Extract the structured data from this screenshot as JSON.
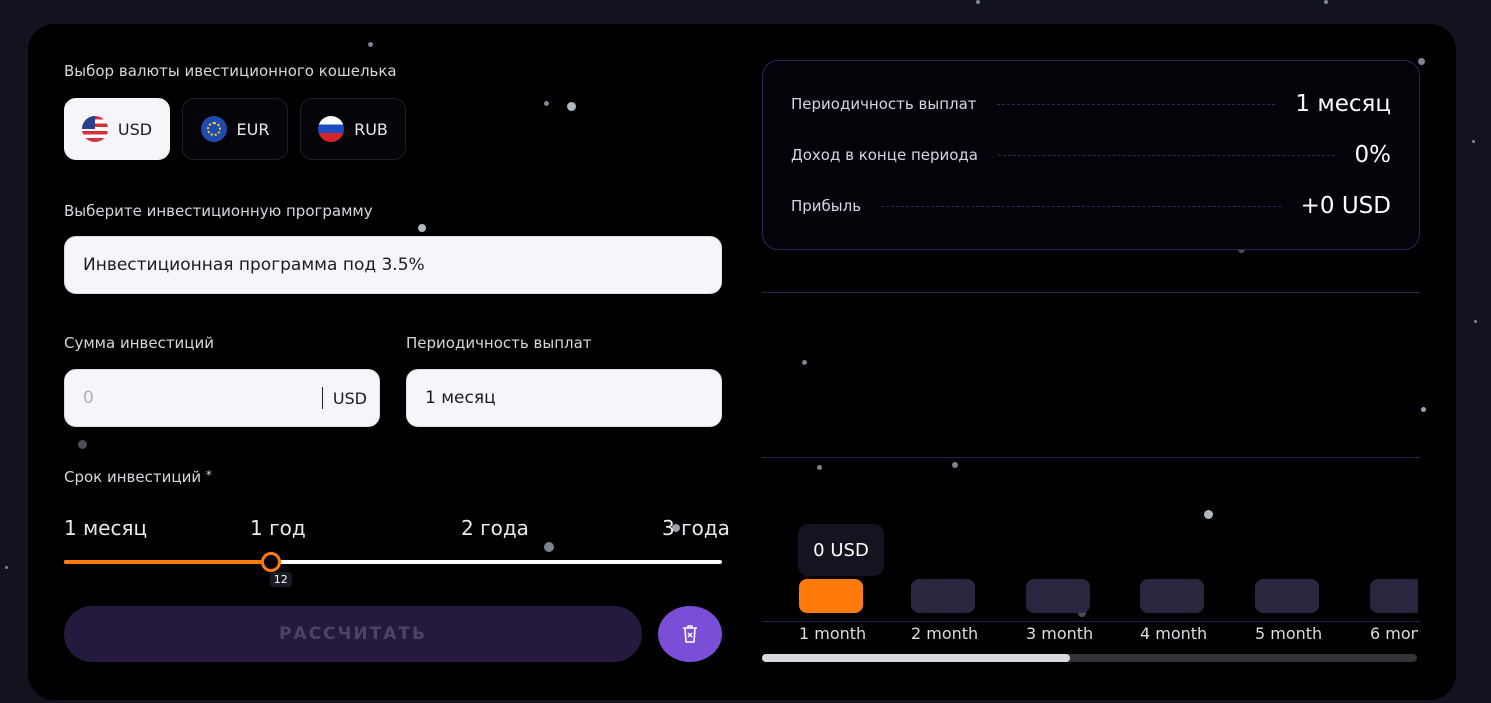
{
  "currency": {
    "label": "Выбор валюты ивестиционного кошелька",
    "options": [
      {
        "code": "USD",
        "flag": "us-flag-icon",
        "active": true
      },
      {
        "code": "EUR",
        "flag": "eu-flag-icon",
        "active": false
      },
      {
        "code": "RUB",
        "flag": "ru-flag-icon",
        "active": false
      }
    ]
  },
  "program": {
    "label": "Выберите инвестиционную программу",
    "value": "Инвестиционная программа под 3.5%"
  },
  "amount": {
    "label": "Сумма инвестиций",
    "placeholder": "0",
    "unit": "USD"
  },
  "period": {
    "label": "Периодичность выплат",
    "value": "1 месяц"
  },
  "term": {
    "label": "Срок инвестиций",
    "required_mark": "*",
    "ticks": [
      "1 месяц",
      "1 год",
      "2 года",
      "3 года"
    ],
    "value": 12,
    "min": 1,
    "max": 36
  },
  "actions": {
    "calculate_label": "РАССЧИТАТЬ",
    "clear_icon": "trash-icon"
  },
  "summary": {
    "rows": [
      {
        "key": "Периодичность выплат",
        "value": "1 месяц"
      },
      {
        "key": "Доход в конце периода",
        "value": "0%"
      },
      {
        "key": "Прибыль",
        "value": "+0 USD"
      }
    ]
  },
  "timeline": {
    "tooltip": "0 USD",
    "months": [
      "1 month",
      "2 month",
      "3 month",
      "4 month",
      "5 month",
      "6 mon"
    ],
    "active_index": 0,
    "scroll_fraction": 0.47
  },
  "colors": {
    "accent": "#ff7a0a",
    "purple": "#7a4ed6",
    "panel": "#000000",
    "background": "#13121f"
  }
}
